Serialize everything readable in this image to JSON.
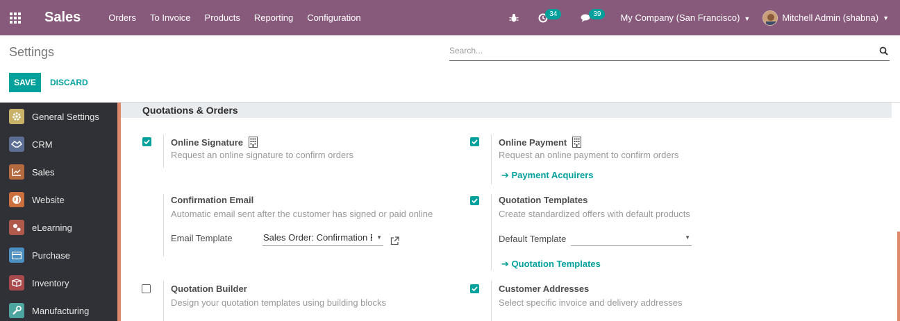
{
  "navbar": {
    "brand": "Sales",
    "menu": [
      "Orders",
      "To Invoice",
      "Products",
      "Reporting",
      "Configuration"
    ],
    "activity_badge": "34",
    "messages_badge": "39",
    "company": "My Company (San Francisco)",
    "user": "Mitchell Admin (shabna)"
  },
  "control": {
    "title": "Settings",
    "search_placeholder": "Search...",
    "save_label": "SAVE",
    "discard_label": "DISCARD"
  },
  "sidebar": {
    "items": [
      {
        "label": "General Settings",
        "icon": "gear-icon",
        "color": "#c8b26a"
      },
      {
        "label": "CRM",
        "icon": "handshake-icon",
        "color": "#5b6f93"
      },
      {
        "label": "Sales",
        "icon": "chart-icon",
        "color": "#b36a3e"
      },
      {
        "label": "Website",
        "icon": "globe-icon",
        "color": "#c9703e"
      },
      {
        "label": "eLearning",
        "icon": "elearning-icon",
        "color": "#b05a4e"
      },
      {
        "label": "Purchase",
        "icon": "credit-card-icon",
        "color": "#4a8fbf"
      },
      {
        "label": "Inventory",
        "icon": "box-icon",
        "color": "#a8494b"
      },
      {
        "label": "Manufacturing",
        "icon": "wrench-icon",
        "color": "#4da59f"
      }
    ]
  },
  "section": {
    "title": "Quotations & Orders"
  },
  "settings": {
    "online_signature": {
      "title": "Online Signature",
      "desc": "Request an online signature to confirm orders",
      "checked": true
    },
    "online_payment": {
      "title": "Online Payment",
      "desc": "Request an online payment to confirm orders",
      "checked": true,
      "link": "Payment Acquirers"
    },
    "confirmation_email": {
      "title": "Confirmation Email",
      "desc": "Automatic email sent after the customer has signed or paid online",
      "field_label": "Email Template",
      "field_value": "Sales Order: Confirmation E"
    },
    "quotation_templates": {
      "title": "Quotation Templates",
      "desc": "Create standardized offers with default products",
      "checked": true,
      "field_label": "Default Template",
      "field_value": "",
      "link": "Quotation Templates"
    },
    "quotation_builder": {
      "title": "Quotation Builder",
      "desc": "Design your quotation templates using building blocks",
      "checked": false
    },
    "customer_addresses": {
      "title": "Customer Addresses",
      "desc": "Select specific invoice and delivery addresses",
      "checked": true
    }
  },
  "colors": {
    "navbar": "#875a7b",
    "accent": "#00a09d",
    "sidebar": "#2f3136",
    "section_bar": "#e0886a"
  }
}
